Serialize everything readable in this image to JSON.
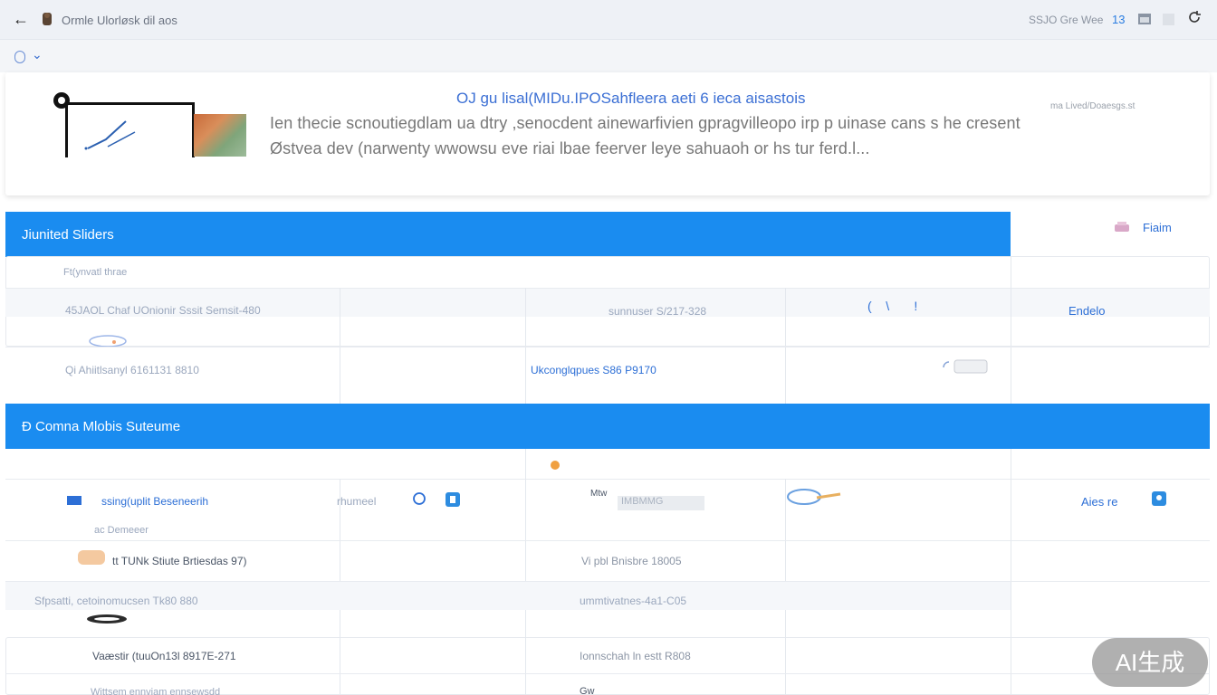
{
  "topbar": {
    "title": "Ormle Ulorløsk dil aos",
    "right_text": "SSJO Gre Wee",
    "right_count": "13"
  },
  "article": {
    "title": "OJ gu lisal(MIDu.IPOSahfleera aeti 6 ieca aisastois",
    "source": "ma Lived/Doaesgs.st",
    "line1": "Ien thecie scnoutiegdlam ua dtry ,senocdent ainewarfivien gpragvilleopo irp p uinase cans s he cresent",
    "line2": "Østvea dev (narwenty wwowsu eve riai lbae feerver leye sahuaoh or hs tur ferd.l..."
  },
  "section1": {
    "title": "Jiunited Sliders",
    "right_label": "Fiaim",
    "sub_label": "Ft(ynvatl thrae",
    "rows": [
      {
        "c1": "45JAOL Chaf UOnionir Sssit Semsit-480",
        "c3": "sunnuser S/217-328",
        "c5": "Endelo"
      },
      {
        "c1": "Qi Ahiitlsanyl 6161131 8810",
        "c3": "Ukconglqpues S86 P9170",
        "c5": ""
      }
    ]
  },
  "section2": {
    "title": "Ɖ Comna Mlobis Suteume",
    "rows": [
      {
        "c1": "ssing(uplit Beseneerih",
        "c1b": "ac Demeeer",
        "c2": "rhumeel",
        "c3": "Mtw",
        "c3b": "IMBMMG",
        "c5": "Aies re"
      },
      {
        "c1": "tt TUNk Stiute Brtiesdas 97)",
        "c3": "Vi pbl Bnisbre 18005"
      },
      {
        "c1": "Sfpsatti, cetoinomucsen Tk80 880",
        "c3": "ummtivatnes-4a1-C05"
      },
      {
        "c1": "Vaæstir (tuuOn13l 8917E-271",
        "c3": "Ionnschah ln estt R808"
      },
      {
        "c1": "Wittsem ennviam ennsewsdd",
        "c3": "Gw"
      }
    ]
  },
  "badge": "AI生成",
  "colors": {
    "accent": "#1a8cf0",
    "link": "#3b6fd4",
    "header_bg": "#eef1f6"
  }
}
